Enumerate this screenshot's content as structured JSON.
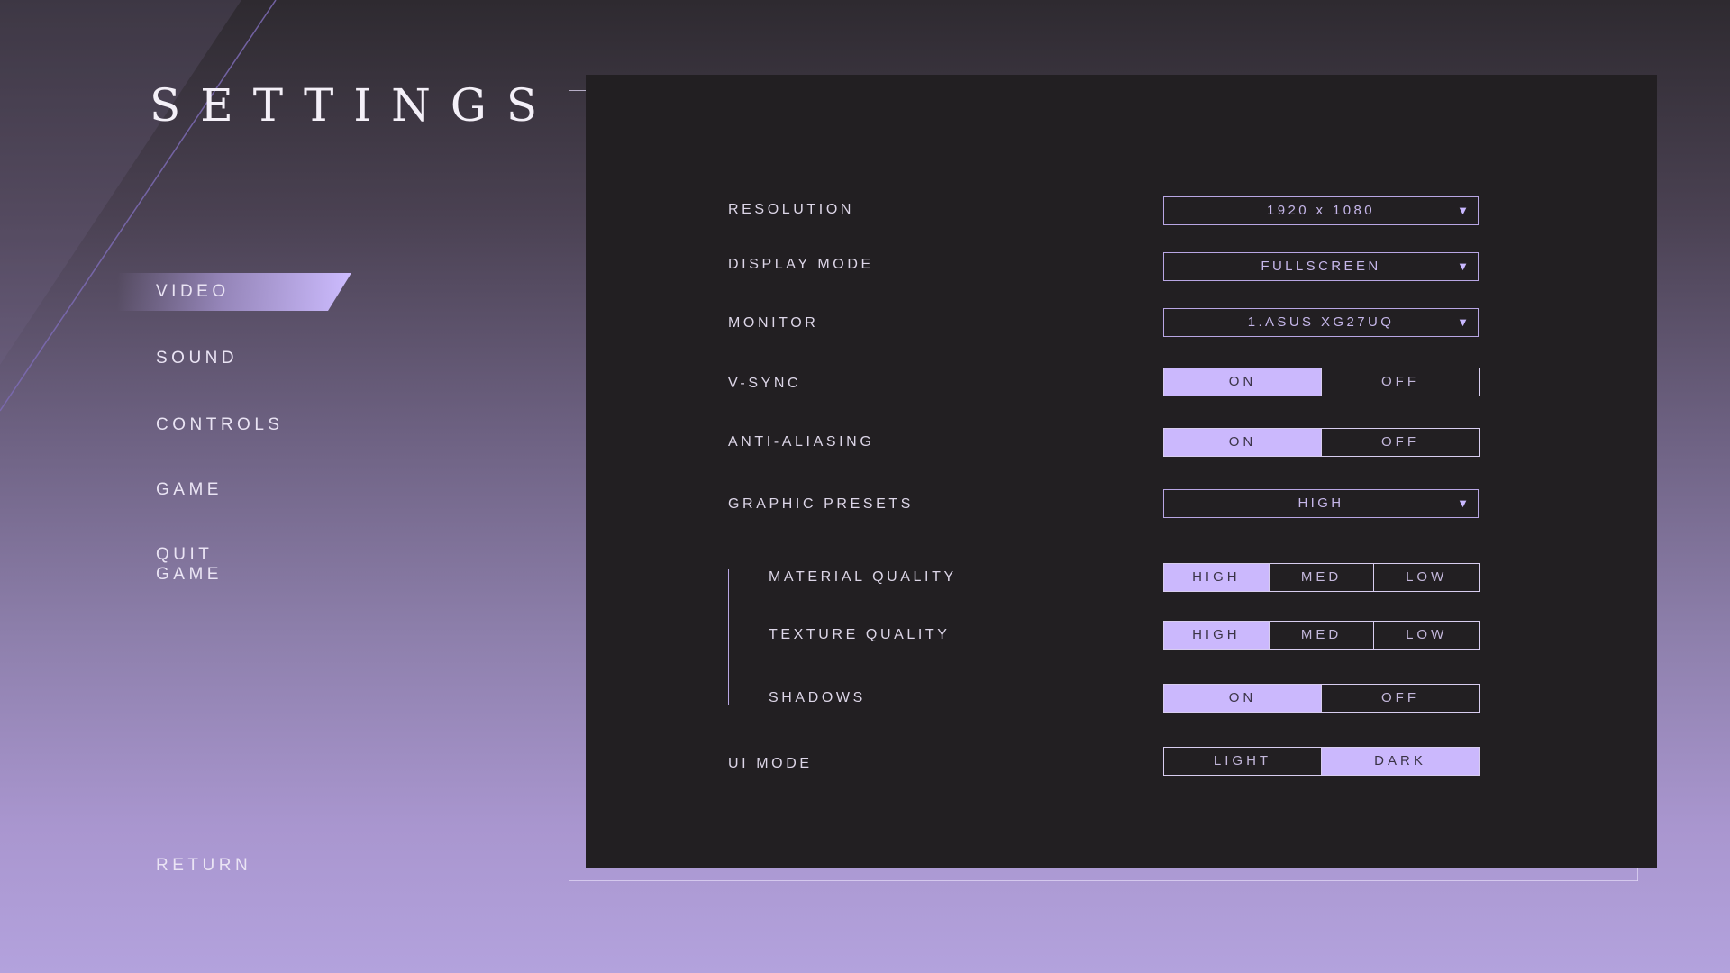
{
  "title": "SETTINGS",
  "nav": {
    "items": [
      {
        "label": "VIDEO",
        "active": true
      },
      {
        "label": "SOUND",
        "active": false
      },
      {
        "label": "CONTROLS",
        "active": false
      },
      {
        "label": "GAME",
        "active": false
      },
      {
        "label": "QUIT GAME",
        "active": false
      }
    ],
    "return_label": "RETURN"
  },
  "settings": {
    "resolution": {
      "label": "RESOLUTION",
      "value": "1920 x 1080"
    },
    "display_mode": {
      "label": "DISPLAY MODE",
      "value": "FULLSCREEN"
    },
    "monitor": {
      "label": "MONITOR",
      "value": "1.ASUS XG27UQ"
    },
    "vsync": {
      "label": "V-SYNC",
      "options": [
        "ON",
        "OFF"
      ],
      "selected": "ON"
    },
    "anti_aliasing": {
      "label": "ANTI-ALIASING",
      "options": [
        "ON",
        "OFF"
      ],
      "selected": "ON"
    },
    "graphic_presets": {
      "label": "GRAPHIC PRESETS",
      "value": "HIGH"
    },
    "material_quality": {
      "label": "MATERIAL QUALITY",
      "options": [
        "HIGH",
        "MED",
        "LOW"
      ],
      "selected": "HIGH"
    },
    "texture_quality": {
      "label": "TEXTURE QUALITY",
      "options": [
        "HIGH",
        "MED",
        "LOW"
      ],
      "selected": "HIGH"
    },
    "shadows": {
      "label": "SHADOWS",
      "options": [
        "ON",
        "OFF"
      ],
      "selected": "ON"
    },
    "ui_mode": {
      "label": "UI MODE",
      "options": [
        "LIGHT",
        "DARK"
      ],
      "selected": "DARK"
    }
  },
  "icons": {
    "dropdown_arrow": "chevron-down-icon"
  },
  "colors": {
    "accent": "#cbb8fd",
    "panel": "#221f22",
    "accent_border": "#b8a6e4"
  }
}
